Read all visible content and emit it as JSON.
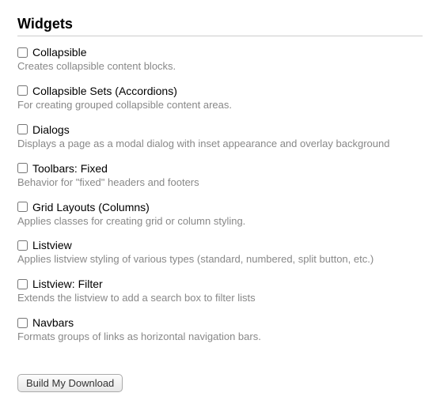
{
  "section_title": "Widgets",
  "items": [
    {
      "label": "Collapsible",
      "desc": "Creates collapsible content blocks."
    },
    {
      "label": "Collapsible Sets (Accordions)",
      "desc": "For creating grouped collapsible content areas."
    },
    {
      "label": "Dialogs",
      "desc": "Displays a page as a modal dialog with inset appearance and overlay background"
    },
    {
      "label": "Toolbars: Fixed",
      "desc": "Behavior for \"fixed\" headers and footers"
    },
    {
      "label": "Grid Layouts (Columns)",
      "desc": "Applies classes for creating grid or column styling."
    },
    {
      "label": "Listview",
      "desc": "Applies listview styling of various types (standard, numbered, split button, etc.)"
    },
    {
      "label": "Listview: Filter",
      "desc": "Extends the listview to add a search box to filter lists"
    },
    {
      "label": "Navbars",
      "desc": "Formats groups of links as horizontal navigation bars."
    }
  ],
  "build_button_label": "Build My Download"
}
